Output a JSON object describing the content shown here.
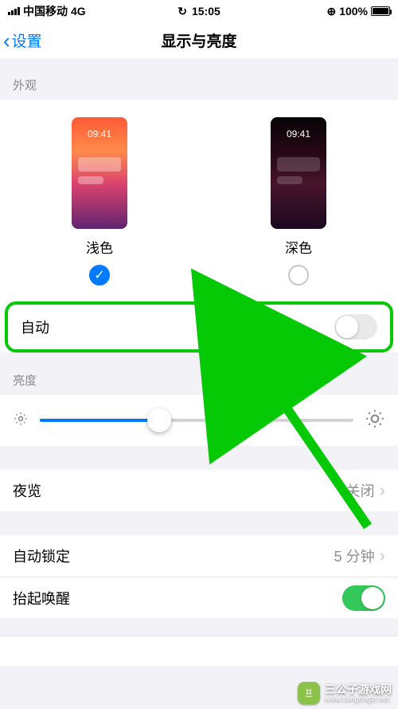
{
  "status": {
    "carrier": "中国移动",
    "network": "4G",
    "time": "15:05",
    "battery_pct": "100%"
  },
  "nav": {
    "back_label": "设置",
    "title": "显示与亮度"
  },
  "appearance": {
    "header": "外观",
    "light_label": "浅色",
    "dark_label": "深色",
    "preview_time": "09:41",
    "selected": "light",
    "auto_label": "自动",
    "auto_on": false
  },
  "brightness": {
    "header": "亮度",
    "value_pct": 38
  },
  "night_shift": {
    "label": "夜览",
    "value": "关闭"
  },
  "auto_lock": {
    "label": "自动锁定",
    "value": "5 分钟"
  },
  "raise_to_wake": {
    "label": "抬起唤醒",
    "on": true
  },
  "annotation": {
    "highlight_color": "#05c905",
    "arrow_color": "#05c905"
  },
  "watermark": {
    "brand": "三公子游戏网",
    "url": "www.sangongzi.net"
  }
}
